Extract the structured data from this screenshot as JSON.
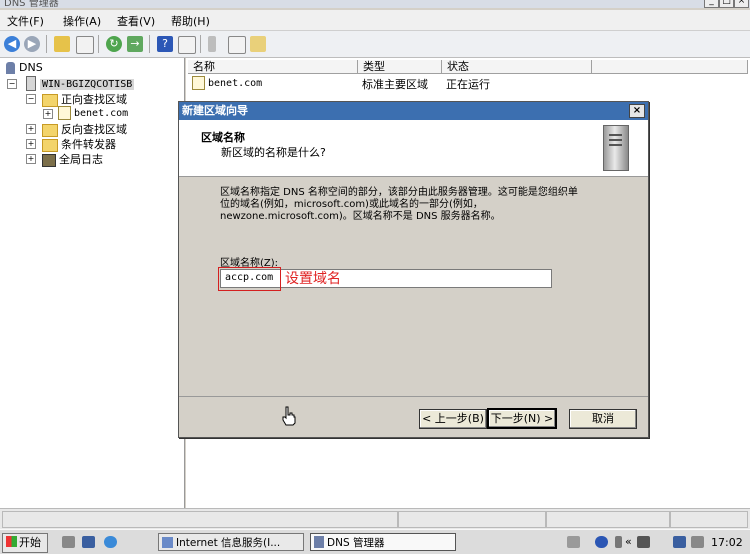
{
  "window": {
    "title": "DNS 管理器",
    "controls": [
      "_",
      "□",
      "×"
    ]
  },
  "menu": [
    {
      "label": "文件(F)"
    },
    {
      "label": "操作(A)"
    },
    {
      "label": "查看(V)"
    },
    {
      "label": "帮助(H)"
    }
  ],
  "toolbar": {
    "icons": [
      "back-arrow-icon",
      "forward-arrow-icon",
      "up-folder-icon",
      "show-hide-tree-icon",
      "refresh-icon",
      "export-icon",
      "help-icon",
      "properties-icon",
      "server-icon",
      "list-icon",
      "zone-icon"
    ]
  },
  "tree": {
    "root": "DNS",
    "server": "WIN-BGIZQCOTISB",
    "forward_zones": "正向查找区域",
    "zone_item": "benet.com",
    "reverse_zones": "反向查找区域",
    "conditional_forwarders": "条件转发器",
    "global_logs": "全局日志"
  },
  "list": {
    "columns": [
      "名称",
      "类型",
      "状态"
    ],
    "rows": [
      {
        "name": "benet.com",
        "type": "标准主要区域",
        "status": "正在运行"
      }
    ]
  },
  "dialog": {
    "title": "新建区域向导",
    "close": "×",
    "header_title": "区域名称",
    "header_subtitle": "新区域的名称是什么?",
    "description_lines": [
      "区域名称指定 DNS 名称空间的部分，该部分由此服务器管理。这可能是您组织单",
      "位的域名(例如，microsoft.com)或此域名的一部分(例如，",
      "newzone.microsoft.com)。区域名称不是 DNS 服务器名称。"
    ],
    "field_label": "区域名称(Z):",
    "field_value": "accp.com",
    "annotation": "设置域名",
    "annotation_color": "#e02424",
    "buttons": {
      "back": "< 上一步(B)",
      "next": "下一步(N) >",
      "cancel": "取消"
    }
  },
  "taskbar": {
    "start": "开始",
    "tasks": [
      {
        "label": "Internet 信息服务(I..."
      },
      {
        "label": "DNS 管理器"
      }
    ],
    "time": "17:02"
  }
}
